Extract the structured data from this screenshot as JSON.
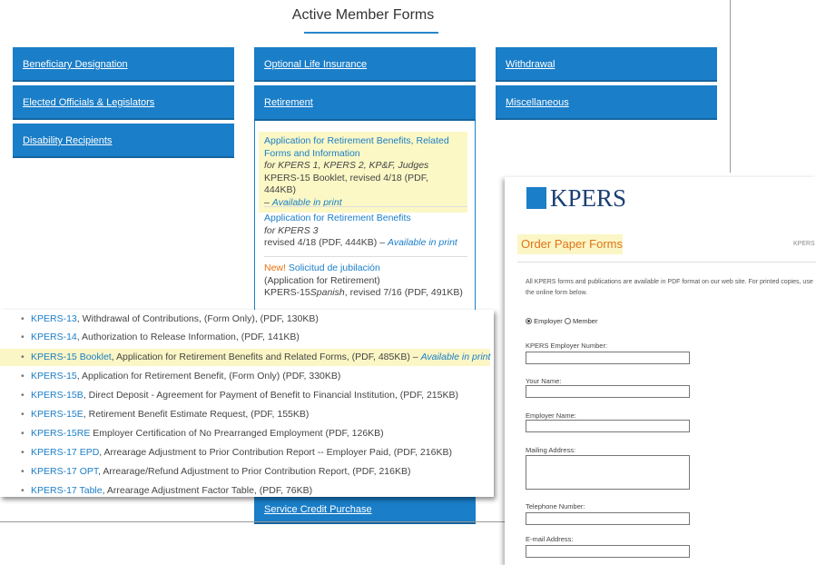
{
  "page_title": "Active Member Forms",
  "buttons": {
    "beneficiary": "Beneficiary Designation",
    "elected": "Elected Officials & Legislators",
    "disability": "Disability Recipients",
    "optional_life": "Optional Life Insurance",
    "retirement": "Retirement",
    "withdrawal": "Withdrawal",
    "misc": "Miscellaneous",
    "service_credit": "Service Credit Purchase"
  },
  "retirement_panel": {
    "e1_link": "Application for Retirement Benefits, Related Forms and Information",
    "e1_sub": "for KPERS 1, KPERS 2, KP&F, Judges",
    "e1_meta": "KPERS-15 Booklet, revised 4/18 (PDF, 444KB)",
    "e1_dash": "–",
    "e1_avail": "Available in print",
    "e2_link": "Application for Retirement Benefits",
    "e2_sub": "for KPERS 3",
    "e2_meta": "revised 4/18 (PDF, 444KB) –",
    "e2_avail": "Available in print",
    "e3_new": "New!",
    "e3_link": "Solicitud de jubilación",
    "e3_sub": "(Application for Retirement)",
    "e3_meta_a": "KPERS-15",
    "e3_meta_b": "Spanish",
    "e3_meta_c": ", revised 7/16 (PDF, 491KB)"
  },
  "kpers_order": {
    "logo_text": "KPERS",
    "heading": "Order Paper Forms",
    "crumb": "KPERS",
    "intro": "All KPERS forms and publications are available in PDF format on our web site. For printed copies, use the online form below.",
    "radio_employer": "Employer",
    "radio_member": "Member",
    "labels": [
      "KPERS Employer Number:",
      "Your Name:",
      "Employer Name:",
      "Mailing Address:",
      "Telephone Number:",
      "E-mail Address:"
    ]
  },
  "forms_list": [
    {
      "link": "KPERS-13",
      "text": ", Withdrawal of Contributions, (Form Only), (PDF, 130KB)"
    },
    {
      "link": "KPERS-14",
      "text": ", Authorization to Release Information, (PDF, 141KB)"
    },
    {
      "link": "KPERS-15 Booklet",
      "text": ", Application for Retirement Benefits and Related Forms, (PDF, 485KB) –",
      "avail": "Available in print"
    },
    {
      "link": "KPERS-15",
      "text": ", Application for Retirement Benefit, (Form Only) (PDF, 330KB)"
    },
    {
      "link": "KPERS-15B",
      "text": ", Direct Deposit - Agreement for Payment of Benefit to Financial Institution, (PDF, 215KB)"
    },
    {
      "link": "KPERS-15E",
      "text": ", Retirement Benefit Estimate Request, (PDF, 155KB)"
    },
    {
      "link": "KPERS-15RE",
      "text": " Employer Certification of No Prearranged Employment (PDF, 126KB)"
    },
    {
      "link": "KPERS-17 EPD",
      "text": ", Arrearage Adjustment to Prior Contribution Report -- Employer Paid, (PDF, 216KB)"
    },
    {
      "link": "KPERS-17 OPT",
      "text": ", Arrearage/Refund Adjustment to Prior Contribution Report, (PDF, 216KB)"
    },
    {
      "link": "KPERS-17 Table",
      "text": ", Arrearage Adjustment Factor Table, (PDF, 76KB)"
    }
  ],
  "bullet": "•",
  "colors": {
    "accent": "#1a7ec8",
    "highlight": "#fbf6c5",
    "new_orange": "#e8730d"
  }
}
